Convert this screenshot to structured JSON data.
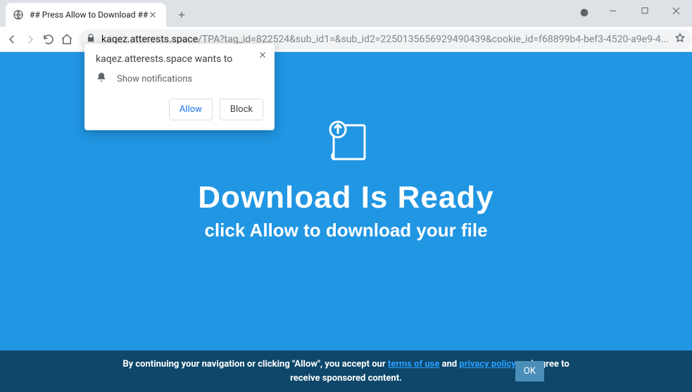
{
  "window": {
    "tab_title": "## Press Allow to Download ##"
  },
  "address": {
    "domain": "kaqez.atterests.space",
    "path": "/TPA?tag_id=822524&sub_id1=&sub_id2=2250135656929490439&cookie_id=f68899b4-bef3-4520-a9e9-4..."
  },
  "notification": {
    "origin_wants": "kaqez.atterests.space wants to",
    "permission_label": "Show notifications",
    "allow": "Allow",
    "block": "Block"
  },
  "page": {
    "headline": "Download Is Ready",
    "subheadline": "click Allow to download your file"
  },
  "footer": {
    "pre": "By continuing your navigation or clicking \"Allow\", you accept our ",
    "terms": "terms of use",
    "and": " and ",
    "privacy": "privacy policy",
    "post": " and agree to receive sponsored content.",
    "ok": "OK"
  }
}
